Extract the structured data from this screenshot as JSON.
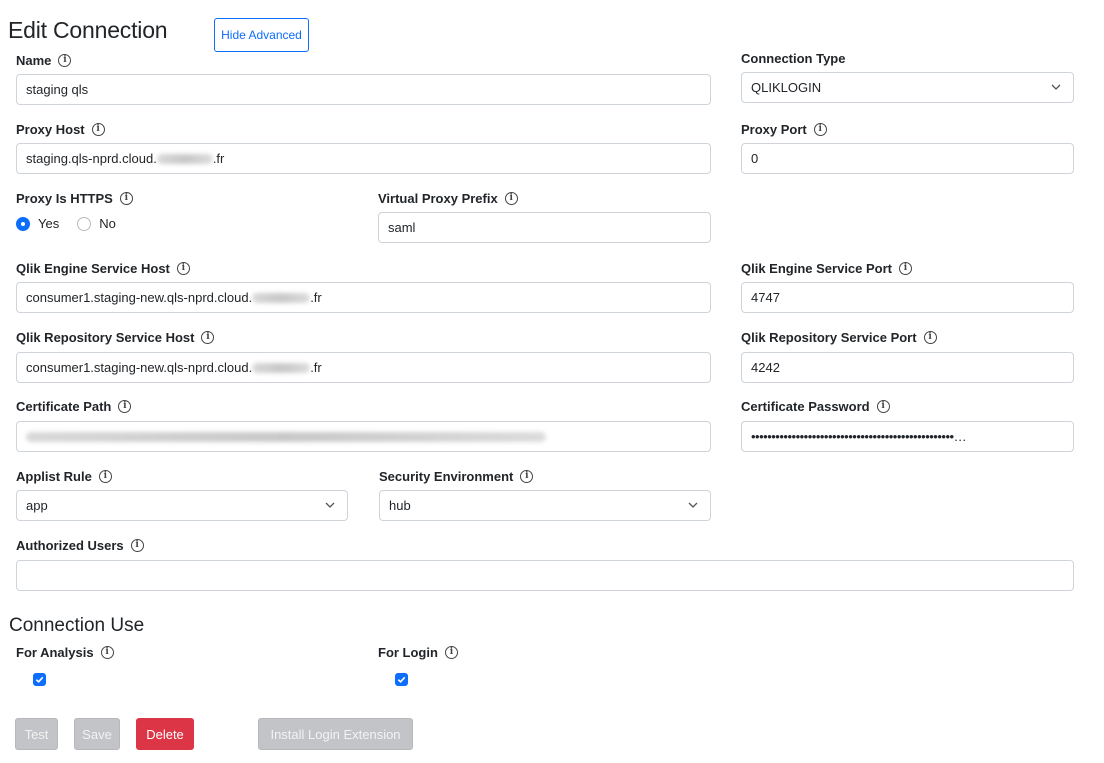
{
  "header": {
    "title": "Edit Connection",
    "hide_advanced_label": "Hide Advanced"
  },
  "fields": {
    "name": {
      "label": "Name",
      "value": "staging qls"
    },
    "connection_type": {
      "label": "Connection Type",
      "value": "QLIKLOGIN"
    },
    "proxy_host": {
      "label": "Proxy Host",
      "value_prefix": "staging.qls-nprd.cloud.",
      "value_suffix": ".fr"
    },
    "proxy_port": {
      "label": "Proxy Port",
      "value": "0"
    },
    "proxy_is_https": {
      "label": "Proxy Is HTTPS",
      "option_yes": "Yes",
      "option_no": "No",
      "selected": "Yes"
    },
    "virtual_proxy_prefix": {
      "label": "Virtual Proxy Prefix",
      "value": "saml"
    },
    "engine_host": {
      "label": "Qlik Engine Service Host",
      "value_prefix": "consumer1.staging-new.qls-nprd.cloud.",
      "value_suffix": ".fr"
    },
    "engine_port": {
      "label": "Qlik Engine Service Port",
      "value": "4747"
    },
    "repository_host": {
      "label": "Qlik Repository Service Host",
      "value_prefix": "consumer1.staging-new.qls-nprd.cloud.",
      "value_suffix": ".fr"
    },
    "repository_port": {
      "label": "Qlik Repository Service Port",
      "value": "4242"
    },
    "certificate_path": {
      "label": "Certificate Path"
    },
    "certificate_password": {
      "label": "Certificate Password",
      "value": "••••••••••••••••••••••••••••••••••••••••••••••••••…"
    },
    "applist_rule": {
      "label": "Applist Rule",
      "value": "app"
    },
    "security_environment": {
      "label": "Security Environment",
      "value": "hub"
    },
    "authorized_users": {
      "label": "Authorized Users",
      "value": ""
    }
  },
  "connection_use": {
    "title": "Connection Use",
    "for_analysis": {
      "label": "For Analysis",
      "checked": true
    },
    "for_login": {
      "label": "For Login",
      "checked": true
    }
  },
  "actions": {
    "test": "Test",
    "save": "Save",
    "delete": "Delete",
    "install_login_extension": "Install Login Extension"
  },
  "colors": {
    "primary": "#0d6efd",
    "danger": "#dc3545",
    "disabled": "#c2c4c7"
  }
}
